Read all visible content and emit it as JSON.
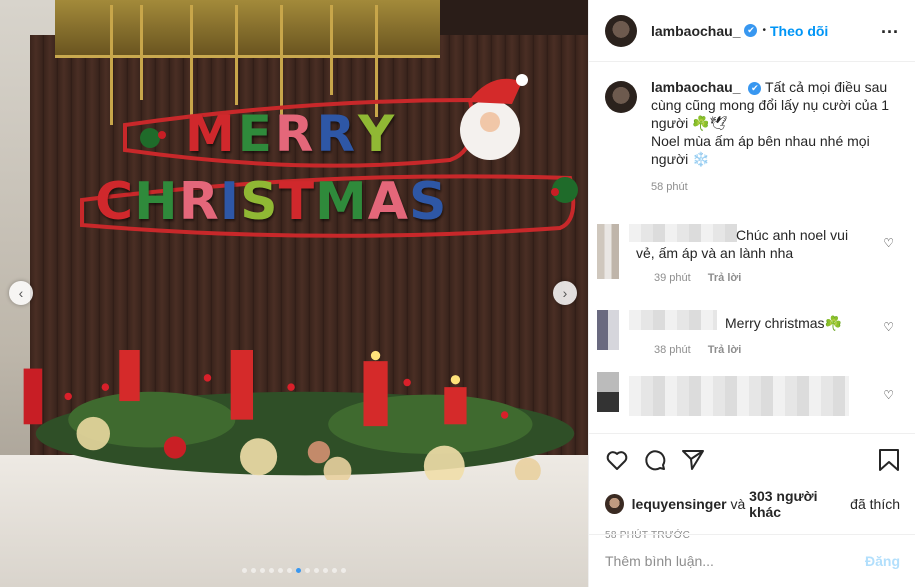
{
  "header": {
    "username": "lambaochau_",
    "verified_mark": "✔",
    "separator": "•",
    "follow_label": "Theo dõi",
    "more_label": "..."
  },
  "caption": {
    "username": "lambaochau_",
    "line1": "Tất cả mọi điều sau cùng cũng mong đổi lấy nụ cười của 1 người ☘️🕊",
    "line2": "Noel mùa ấm áp bên nhau nhé mọi người ❄️",
    "time": "58 phút"
  },
  "comments": [
    {
      "text": "Chúc anh noel vui vẻ, ấm áp và an lành nha",
      "time": "39 phút",
      "reply": "Trả lời"
    },
    {
      "text": "Merry christmas☘️",
      "time": "38 phút",
      "reply": "Trả lời"
    }
  ],
  "likes": {
    "first_user": "lequyensinger",
    "connector": " và ",
    "others": "303 người khác",
    "suffix": " đã thích"
  },
  "posted_ago": "58 PHÚT TRƯỚC",
  "add_comment": {
    "placeholder": "Thêm bình luận...",
    "post_label": "Đăng"
  },
  "photo": {
    "banner_top": "MERRY",
    "banner_bottom": "CHRISTMAS",
    "carousel_total": 12,
    "carousel_active": 7,
    "prev_icon": "‹",
    "next_icon": "›"
  },
  "colors": {
    "accent": "#0095f6",
    "verified": "#3897f0"
  }
}
